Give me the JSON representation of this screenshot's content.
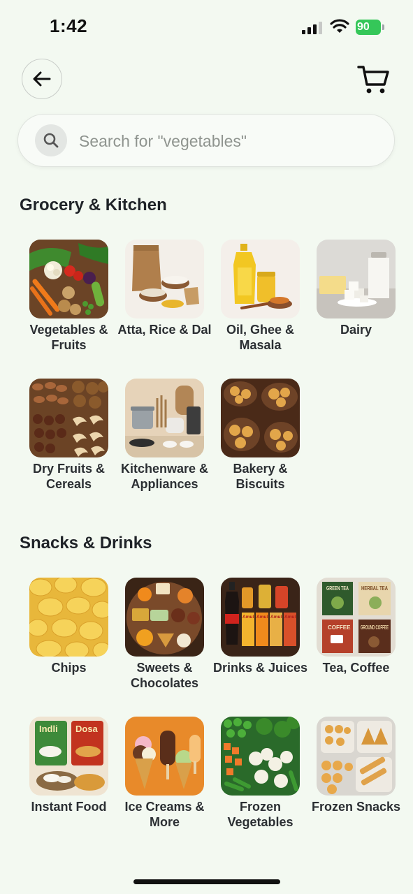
{
  "status_bar": {
    "time": "1:42",
    "battery": "90"
  },
  "header": {
    "back_icon": "arrow-left-icon",
    "cart_icon": "cart-icon"
  },
  "search": {
    "placeholder": "Search for \"vegetables\"",
    "icon": "search-icon"
  },
  "sections": [
    {
      "title": "Grocery & Kitchen",
      "items": [
        {
          "label": "Vegetables & Fruits"
        },
        {
          "label": "Atta, Rice & Dal"
        },
        {
          "label": "Oil, Ghee & Masala"
        },
        {
          "label": "Dairy"
        },
        {
          "label": "Dry Fruits & Cereals"
        },
        {
          "label": "Kitchenware & Appliances"
        },
        {
          "label": "Bakery & Biscuits"
        }
      ]
    },
    {
      "title": "Snacks & Drinks",
      "items": [
        {
          "label": "Chips"
        },
        {
          "label": "Sweets & Chocolates"
        },
        {
          "label": "Drinks & Juices"
        },
        {
          "label": "Tea, Coffee"
        },
        {
          "label": "Instant Food"
        },
        {
          "label": "Ice Creams & More"
        },
        {
          "label": "Frozen Vegetables"
        },
        {
          "label": "Frozen Snacks"
        }
      ]
    }
  ],
  "image_text": {
    "green_tea": "GREEN TEA",
    "herbal_tea": "HERBAL TEA",
    "coffee": "COFFEE",
    "ground_coffee": "GROUND COFFEE",
    "indli": "Indli",
    "dosa": "Dosa",
    "amul": "Amul"
  },
  "colors": {
    "background": "#f3f9f1",
    "battery": "#35c759"
  }
}
